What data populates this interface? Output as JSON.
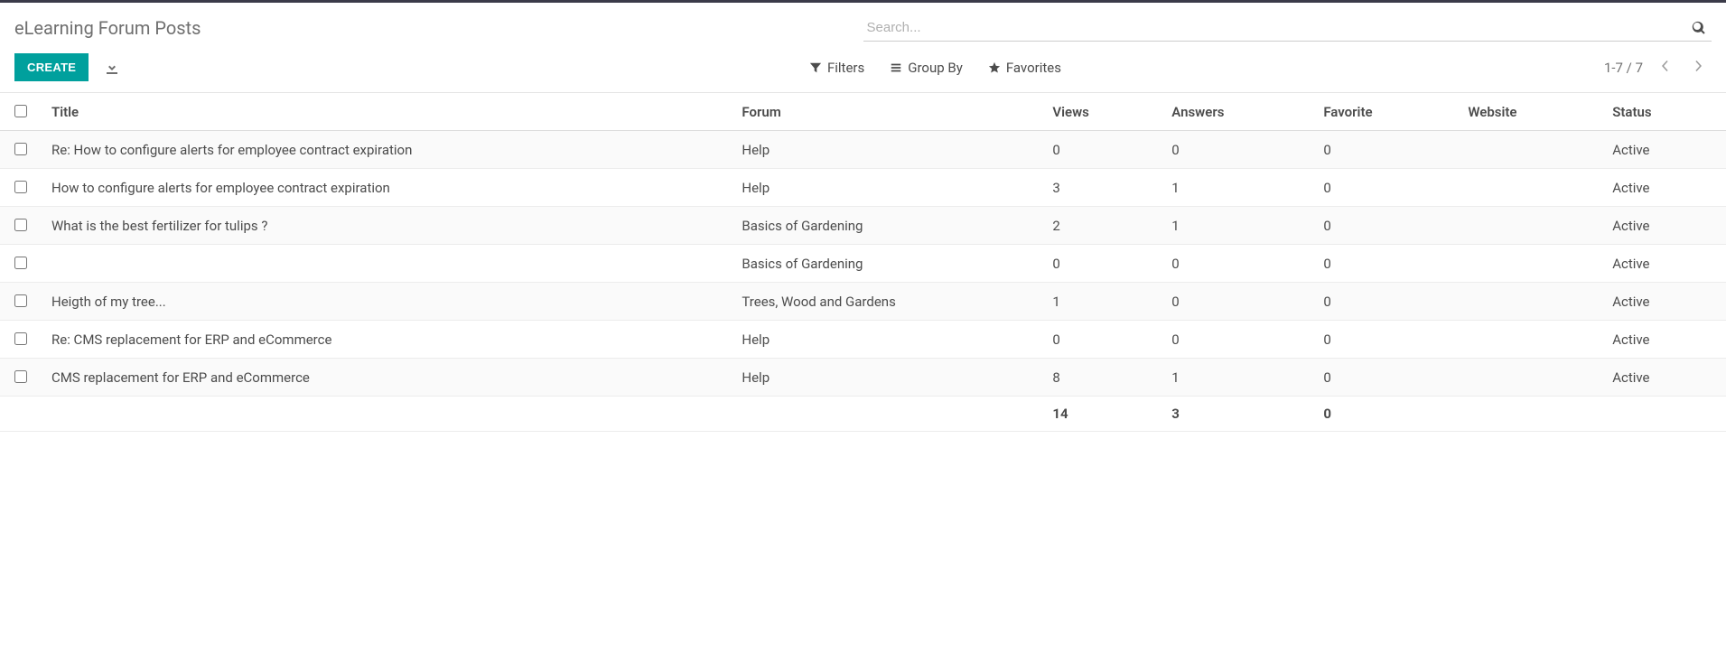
{
  "breadcrumb": "eLearning Forum Posts",
  "search": {
    "placeholder": "Search..."
  },
  "buttons": {
    "create": "CREATE",
    "filters": "Filters",
    "groupby": "Group By",
    "favorites": "Favorites"
  },
  "pager": {
    "text": "1-7 / 7"
  },
  "columns": {
    "title": "Title",
    "forum": "Forum",
    "views": "Views",
    "answers": "Answers",
    "favorite": "Favorite",
    "website": "Website",
    "status": "Status"
  },
  "rows": [
    {
      "title": "Re: How to configure alerts for employee contract expiration",
      "forum": "Help",
      "views": "0",
      "answers": "0",
      "favorite": "0",
      "website": "",
      "status": "Active"
    },
    {
      "title": "How to configure alerts for employee contract expiration",
      "forum": "Help",
      "views": "3",
      "answers": "1",
      "favorite": "0",
      "website": "",
      "status": "Active"
    },
    {
      "title": "What is the best fertilizer for tulips ?",
      "forum": "Basics of Gardening",
      "views": "2",
      "answers": "1",
      "favorite": "0",
      "website": "",
      "status": "Active"
    },
    {
      "title": "",
      "forum": "Basics of Gardening",
      "views": "0",
      "answers": "0",
      "favorite": "0",
      "website": "",
      "status": "Active"
    },
    {
      "title": "Heigth of my tree...",
      "forum": "Trees, Wood and Gardens",
      "views": "1",
      "answers": "0",
      "favorite": "0",
      "website": "",
      "status": "Active"
    },
    {
      "title": "Re: CMS replacement for ERP and eCommerce",
      "forum": "Help",
      "views": "0",
      "answers": "0",
      "favorite": "0",
      "website": "",
      "status": "Active"
    },
    {
      "title": "CMS replacement for ERP and eCommerce",
      "forum": "Help",
      "views": "8",
      "answers": "1",
      "favorite": "0",
      "website": "",
      "status": "Active"
    }
  ],
  "totals": {
    "views": "14",
    "answers": "3",
    "favorite": "0"
  }
}
